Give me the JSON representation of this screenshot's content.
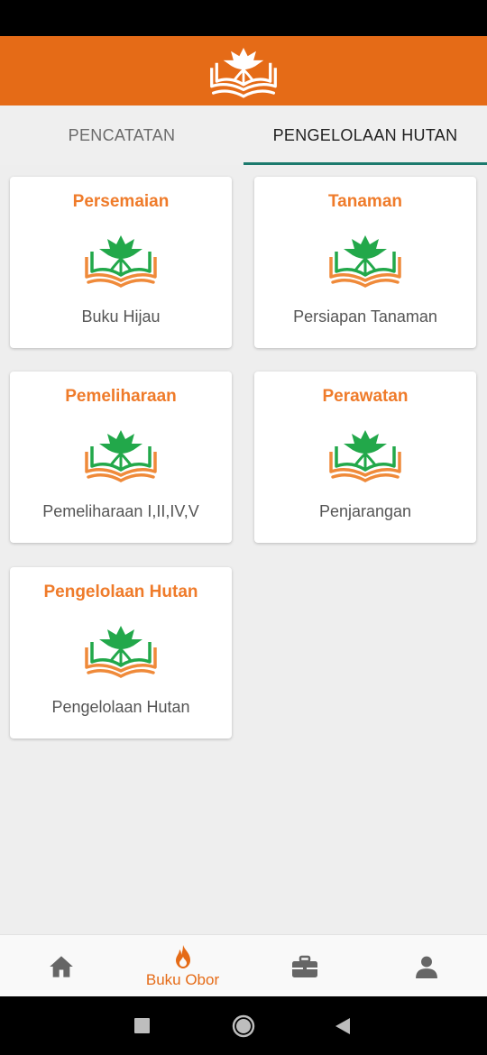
{
  "header": {
    "logo_icon": "book-lotus-logo-icon",
    "color": "#e56b17"
  },
  "tabs": [
    {
      "label": "PENCATATAN",
      "active": false
    },
    {
      "label": "PENGELOLAAN HUTAN",
      "active": true
    }
  ],
  "cards": [
    {
      "title": "Persemaian",
      "subtitle": "Buku Hijau"
    },
    {
      "title": "Tanaman",
      "subtitle": "Persiapan Tanaman"
    },
    {
      "title": "Pemeliharaan",
      "subtitle": "Pemeliharaan I,II,IV,V"
    },
    {
      "title": "Perawatan",
      "subtitle": "Penjarangan"
    },
    {
      "title": "Pengelolaan Hutan",
      "subtitle": "Pengelolaan Hutan"
    }
  ],
  "bottom_nav": {
    "active_label": "Buku Obor",
    "items": [
      "home-icon",
      "flame-icon",
      "briefcase-icon",
      "person-icon"
    ]
  },
  "colors": {
    "accent": "#e56b17",
    "title": "#ef7b2a",
    "logo_green": "#22a84a",
    "tab_indicator": "#1c7a6d"
  }
}
